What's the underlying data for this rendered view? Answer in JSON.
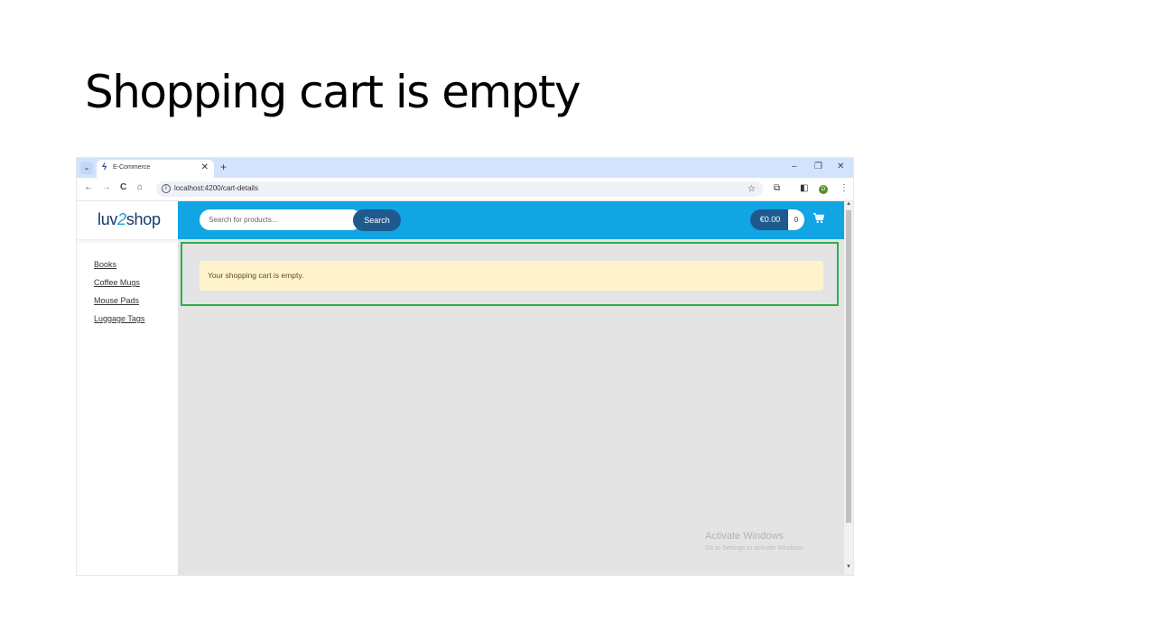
{
  "slide": {
    "title": "Shopping cart is empty"
  },
  "browser": {
    "tab_title": "E-Commerce",
    "new_tab": "+",
    "tab_close": "✕",
    "url": "localhost:4200/cart-details",
    "profile_initial": "D",
    "window_controls": {
      "minimize": "–",
      "restore": "❐",
      "close": "✕"
    },
    "nav": {
      "back": "←",
      "forward": "→",
      "reload": "C",
      "home": "⌂"
    }
  },
  "app": {
    "logo_prefix": "luv",
    "logo_swoosh": "2",
    "logo_suffix": "shop",
    "sidebar": {
      "items": [
        {
          "label": "Books"
        },
        {
          "label": "Coffee Mugs"
        },
        {
          "label": "Mouse Pads"
        },
        {
          "label": "Luggage Tags"
        }
      ]
    },
    "header": {
      "search_placeholder": "Search for products...",
      "search_button": "Search",
      "cart_total": "€0.00",
      "cart_quantity": "0"
    },
    "alert": {
      "text": "Your shopping cart is empty."
    }
  },
  "watermark": {
    "title": "Activate Windows",
    "subtitle": "Go to Settings to activate Windows."
  },
  "colors": {
    "header_bg": "#11a5e3",
    "button_bg": "#1e5a8e",
    "alert_bg": "#fff3cd",
    "highlight_border": "#2fae4a",
    "content_bg": "#e4e4e4",
    "tabstrip_bg": "#d3e3fd"
  }
}
